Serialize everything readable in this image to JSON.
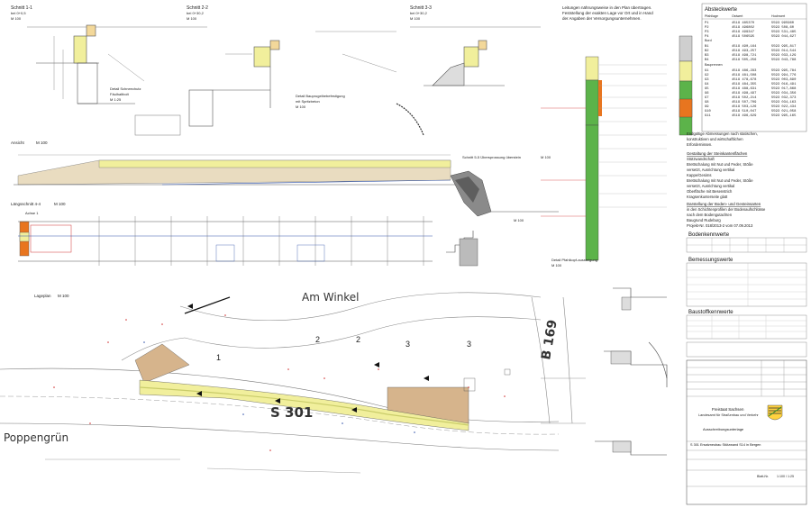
{
  "sections": {
    "s11_title": "Schnitt 1-1",
    "s11_sub": "bei 0+0,5",
    "s11_scale": "M 100",
    "s22_title": "Schnitt 2-2",
    "s22_sub": "bei 0+30,2",
    "s22_scale": "M 100",
    "s33_title": "Schnitt 3-3",
    "s33_sub": "bei 0+30,2",
    "s33_scale": "M 100",
    "s55_title": "Schnitt 5-5 Übersprossung überstein",
    "s55_scale": "M 100",
    "treppe_title": "Schnitt durch Treppe unterstein",
    "treppe_scale": "M 100",
    "detail1": "Detail Schneechutz",
    "detail1b": "Fäulhaltbolt",
    "detail1c": "M 1:25",
    "detail2": "Detail Bauprugelbebefestigung",
    "detail2b": "mit Spritzbeton",
    "detail2c": "M 100",
    "ansicht": "Ansicht",
    "ansicht_scale": "M 100",
    "laengs": "Längsschnitt 4-4",
    "laengs_scale": "M 100",
    "achse": "Achse 1",
    "lageplan": "Lageplan",
    "lageplan_scale": "M 100",
    "pfahl": "Detail Pfahlkopf-aussteigung",
    "pfahl_scale": "M 100"
  },
  "note_top": {
    "lines": [
      "Leitungen nährungsweise in den Plan übertragen.",
      "Feststellung der exakten Lage vor Ort und in Hand",
      "der Angaben der Versorgungsunternehmen."
    ]
  },
  "absteck": {
    "title": "Absteckwerte",
    "col1": "Pfahllage",
    "col2": "Ostwert",
    "col3": "Hochwert",
    "group1_rows": [
      [
        "P1",
        "4519 485370",
        "5593 995960"
      ],
      [
        "P2",
        "4519 496802",
        "5593 508,60"
      ],
      [
        "P3",
        "4519 499347",
        "5593 531,485"
      ],
      [
        "P4",
        "4519 506595",
        "5593 044,627"
      ]
    ],
    "group2": "Bord",
    "group2_rows": [
      [
        "B1",
        "4519 490,164",
        "5593 995,817"
      ],
      [
        "B2",
        "4519 493,257",
        "5593 014,544"
      ],
      [
        "B3",
        "4519 498,721",
        "5593 033,129"
      ],
      [
        "B4",
        "4519 505,256",
        "5593 043,788"
      ]
    ],
    "group3": "Bauprennen",
    "group3_rows": [
      [
        "G1",
        "4519 486,293",
        "5593 995,784"
      ],
      [
        "G2",
        "4519 481,508",
        "5593 994,776"
      ],
      [
        "G3",
        "4519 478,678",
        "5593 003,890"
      ],
      [
        "G4",
        "4519 484,355",
        "5593 016,491"
      ],
      [
        "G5",
        "4519 488,631",
        "5593 017,868"
      ],
      [
        "G6",
        "4519 498,497",
        "5593 034,356"
      ],
      [
        "G7",
        "4519 502,214",
        "5593 032,373"
      ],
      [
        "G8",
        "4519 507,709",
        "5593 034,163"
      ],
      [
        "G9",
        "4519 503,126",
        "5593 022,434"
      ],
      [
        "G10",
        "4519 510,047",
        "5593 021,058"
      ],
      [
        "G11",
        "4519 496,629",
        "5593 995,165"
      ]
    ]
  },
  "notes_right": {
    "p1": [
      "Endgültige Abmessungen nach statischen,",
      "konstruktiven und wirtschaftlichen",
      "Erfordernissen."
    ],
    "h2": "Gestaltung der Steinkantenflächen",
    "h2b": "Stützwandschaft",
    "p2": [
      "Brettschalung mit Nut und Feder, Stöße",
      "versetzt, Ausrichtung vertikal",
      "Kappe/Gesims",
      "Brettschalung mit Nut und Feder, Stöße",
      "versetzt, Ausrichtung vertikal",
      "Oberfläche mit Besenstrich",
      "Kragsenkunterseite glatt"
    ],
    "h3": "Darstellung der Boden- und Gesteinsarten",
    "p3": [
      "in den Schichtenprofilen der Bodenaufschlüsse",
      "nach dem Bodengutachten",
      "Baugrund Rudeburg",
      "Projekt-Nr. 018/2013-2 vom 07.09.2013"
    ]
  },
  "table_headers": {
    "boden": "Bodenkennwerte",
    "bau": "Baustoffkennwerte",
    "bemessung": "Bemessungswerte"
  },
  "map_labels": {
    "street1": "Am Winkel",
    "street2": "B 169",
    "street3": "S 301",
    "place": "Poppengrün"
  },
  "titleblock": {
    "authority": "Freistaat Sachsen",
    "office": "Landesamt für Straßenbau und Verkehr",
    "plan": "Ausschreibungsunterlage",
    "project": "S 301 Ersatzneubau Stützwand S14 in Bergen",
    "sheet": "Blatt-Nr.",
    "scale": "1:100 / 1:25"
  },
  "colors": {
    "green": "#5cb34a",
    "orange": "#e8751f",
    "yellow": "#f1ef9c",
    "tan": "#d6b48c",
    "olive": "#c9cc6a",
    "line": "#444444",
    "red": "#d03030"
  }
}
